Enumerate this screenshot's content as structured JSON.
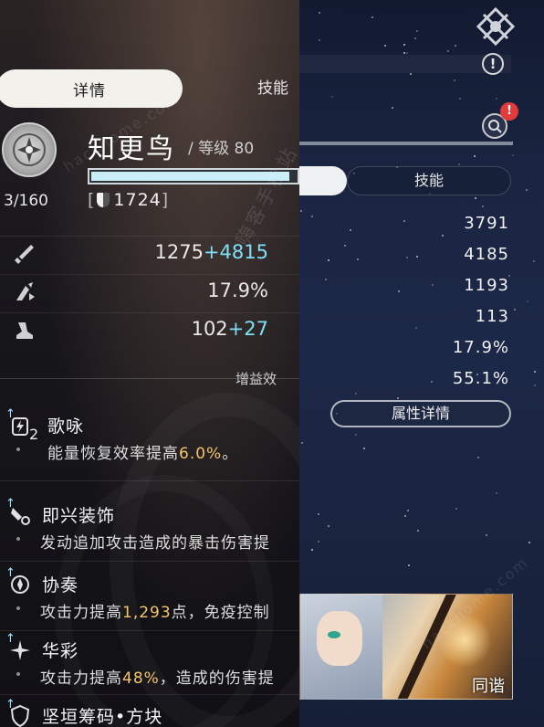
{
  "left_panel": {
    "tabs": {
      "details": "详情",
      "skills": "技能"
    },
    "character": {
      "name": "知更鸟",
      "level_text": "/ 等级 80",
      "exp_count": "3/160",
      "exp_progress": 0.97,
      "power_prefix": "[",
      "power_value": "1724",
      "power_suffix": "]"
    },
    "stats": [
      {
        "icon": "sword-icon",
        "base": "1275",
        "bonus": "+4815"
      },
      {
        "icon": "crit-icon",
        "base": "17.9%",
        "bonus": ""
      },
      {
        "icon": "speed-icon",
        "base": "102",
        "bonus": "+27"
      }
    ],
    "buff_section_label": "增益效",
    "buffs": [
      {
        "icon": "energy-icon",
        "stack": "2",
        "name": "歌咏",
        "desc_pre": "能量恢复效率提高",
        "desc_hl": "6.0%",
        "desc_post": "。"
      },
      {
        "icon": "ornament-icon",
        "stack": "",
        "name": "即兴装饰",
        "desc_pre": "发动追加攻击造成的暴击伤害提",
        "desc_hl": "",
        "desc_post": ""
      },
      {
        "icon": "ensemble-icon",
        "stack": "",
        "name": "协奏",
        "desc_pre": "攻击力提高",
        "desc_hl": "1,293",
        "desc_post": "点，免疫控制"
      },
      {
        "icon": "sparkle-icon",
        "stack": "",
        "name": "华彩",
        "desc_pre": "攻击力提高",
        "desc_hl": "48%",
        "desc_post": "，造成的伤害提"
      },
      {
        "icon": "shield-buff-icon",
        "stack": "",
        "name": "坚垣筹码•方块",
        "desc_pre": "",
        "desc_hl": "",
        "desc_post": ""
      }
    ]
  },
  "right_panel": {
    "tab_skills": "技能",
    "alert_badge": "!",
    "info_symbol": "!",
    "values": [
      "3791",
      "4185",
      "1193",
      "113",
      "17.9%",
      "55.1%"
    ],
    "attr_details_button": "属性详情",
    "portrait_label": "同谐"
  },
  "watermark": {
    "main": "嗨客手机站",
    "url1": "hackhome.com",
    "url2": "hackhome.com"
  },
  "colors": {
    "bonus": "#7ee0f7",
    "highlight": "#f3c46a",
    "alert": "#e23b3b"
  }
}
